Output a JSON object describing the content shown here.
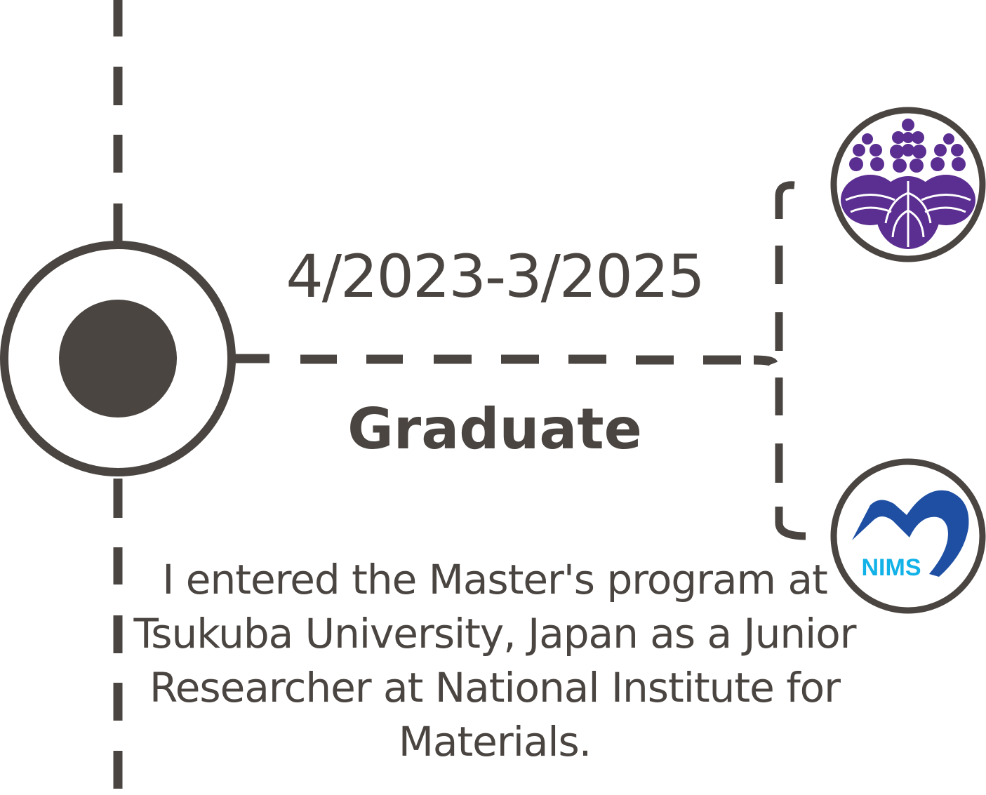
{
  "entry": {
    "date_range": "4/2023-3/2025",
    "role": "Graduate",
    "description": "I entered the Master's program at Tsukuba University, Japan as a Junior Researcher at National Institute for Materials."
  },
  "logos": {
    "university": {
      "icon": "paulownia-crest-icon",
      "color": "#5b2e91"
    },
    "institute": {
      "icon": "nims-logo-icon",
      "text": "NIMS",
      "mark_color": "#1e4fa3",
      "text_color": "#12b2e8"
    }
  },
  "colors": {
    "line": "#4a4541",
    "background": "#ffffff"
  }
}
